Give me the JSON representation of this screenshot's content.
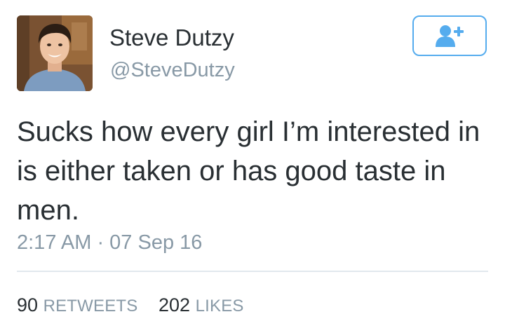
{
  "user": {
    "display_name": "Steve Dutzy",
    "handle": "@SteveDutzy",
    "avatar_icon": "profile-photo"
  },
  "follow_button": {
    "icon": "follow-user-icon",
    "color": "#55acee"
  },
  "tweet": {
    "text": "Sucks how every girl I’m interested in is either taken or has good taste in men.",
    "timestamp": "2:17 AM · 07 Sep 16"
  },
  "stats": {
    "retweets_count": "90",
    "retweets_label": "RETWEETS",
    "likes_count": "202",
    "likes_label": "LIKES"
  },
  "colors": {
    "text": "#292f33",
    "muted": "#8899a6",
    "accent": "#55acee",
    "divider": "#e1e8ed"
  }
}
